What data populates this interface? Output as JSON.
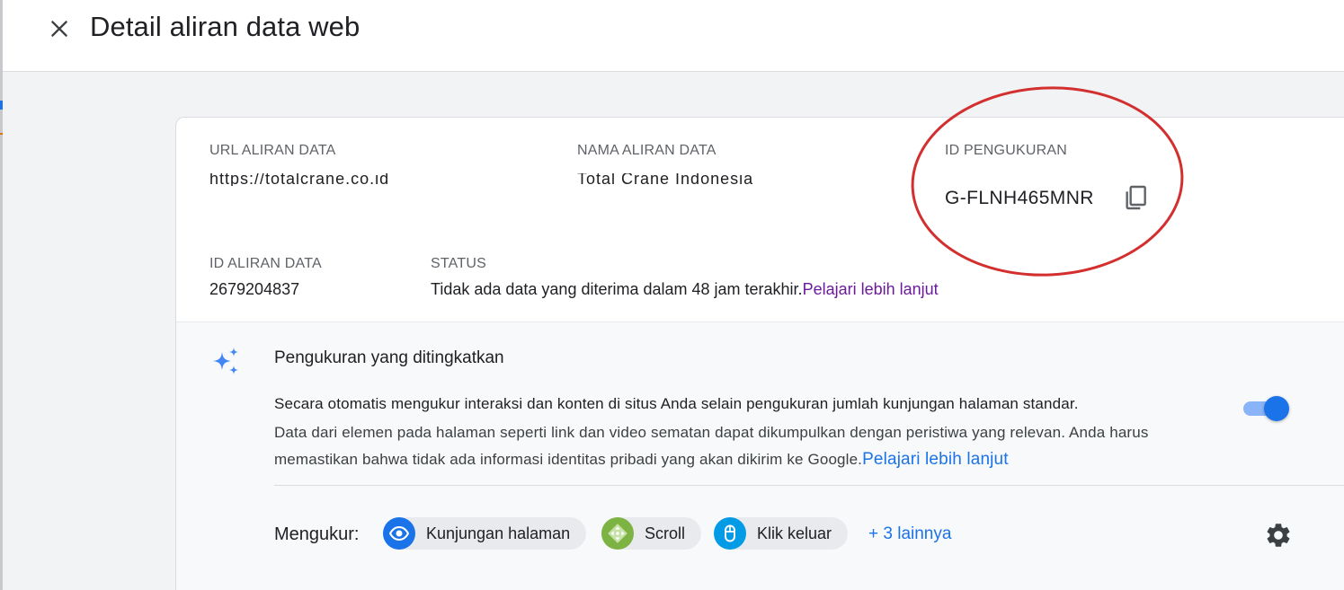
{
  "header": {
    "title": "Detail aliran data web"
  },
  "stream": {
    "url_label": "URL ALIRAN DATA",
    "url_value": "https://totalcrane.co.id",
    "name_label": "NAMA ALIRAN DATA",
    "name_value": "Total Crane Indonesia",
    "measurement_label": "ID PENGUKURAN",
    "measurement_value": "G-FLNH465MNR",
    "stream_id_label": "ID ALIRAN DATA",
    "stream_id_value": "2679204837",
    "status_label": "STATUS",
    "status_text": "Tidak ada data yang diterima dalam 48 jam terakhir.",
    "status_link": "Pelajari lebih lanjut"
  },
  "enhanced": {
    "title": "Pengukuran yang ditingkatkan",
    "desc_bold": "Secara otomatis mengukur interaksi dan konten di situs Anda selain pengukuran jumlah kunjungan halaman standar.",
    "desc": "Data dari elemen pada halaman seperti link dan video sematan dapat dikumpulkan dengan peristiwa yang relevan. Anda harus memastikan bahwa tidak ada informasi identitas pribadi yang akan dikirim ke Google.",
    "desc_link": "Pelajari lebih lanjut",
    "toggle_on": true,
    "measure_label": "Mengukur:",
    "chips": [
      {
        "label": "Kunjungan halaman",
        "icon": "eye-icon",
        "color": "#1a73e8"
      },
      {
        "label": "Scroll",
        "icon": "move-arrows-icon",
        "color": "#7cb342"
      },
      {
        "label": "Klik keluar",
        "icon": "mouse-icon",
        "color": "#039be5"
      }
    ],
    "more_label": "+ 3 lainnya"
  },
  "colors": {
    "accent": "#1a73e8",
    "link_visited": "#6a1b9a",
    "annotation": "#d32f2f"
  }
}
